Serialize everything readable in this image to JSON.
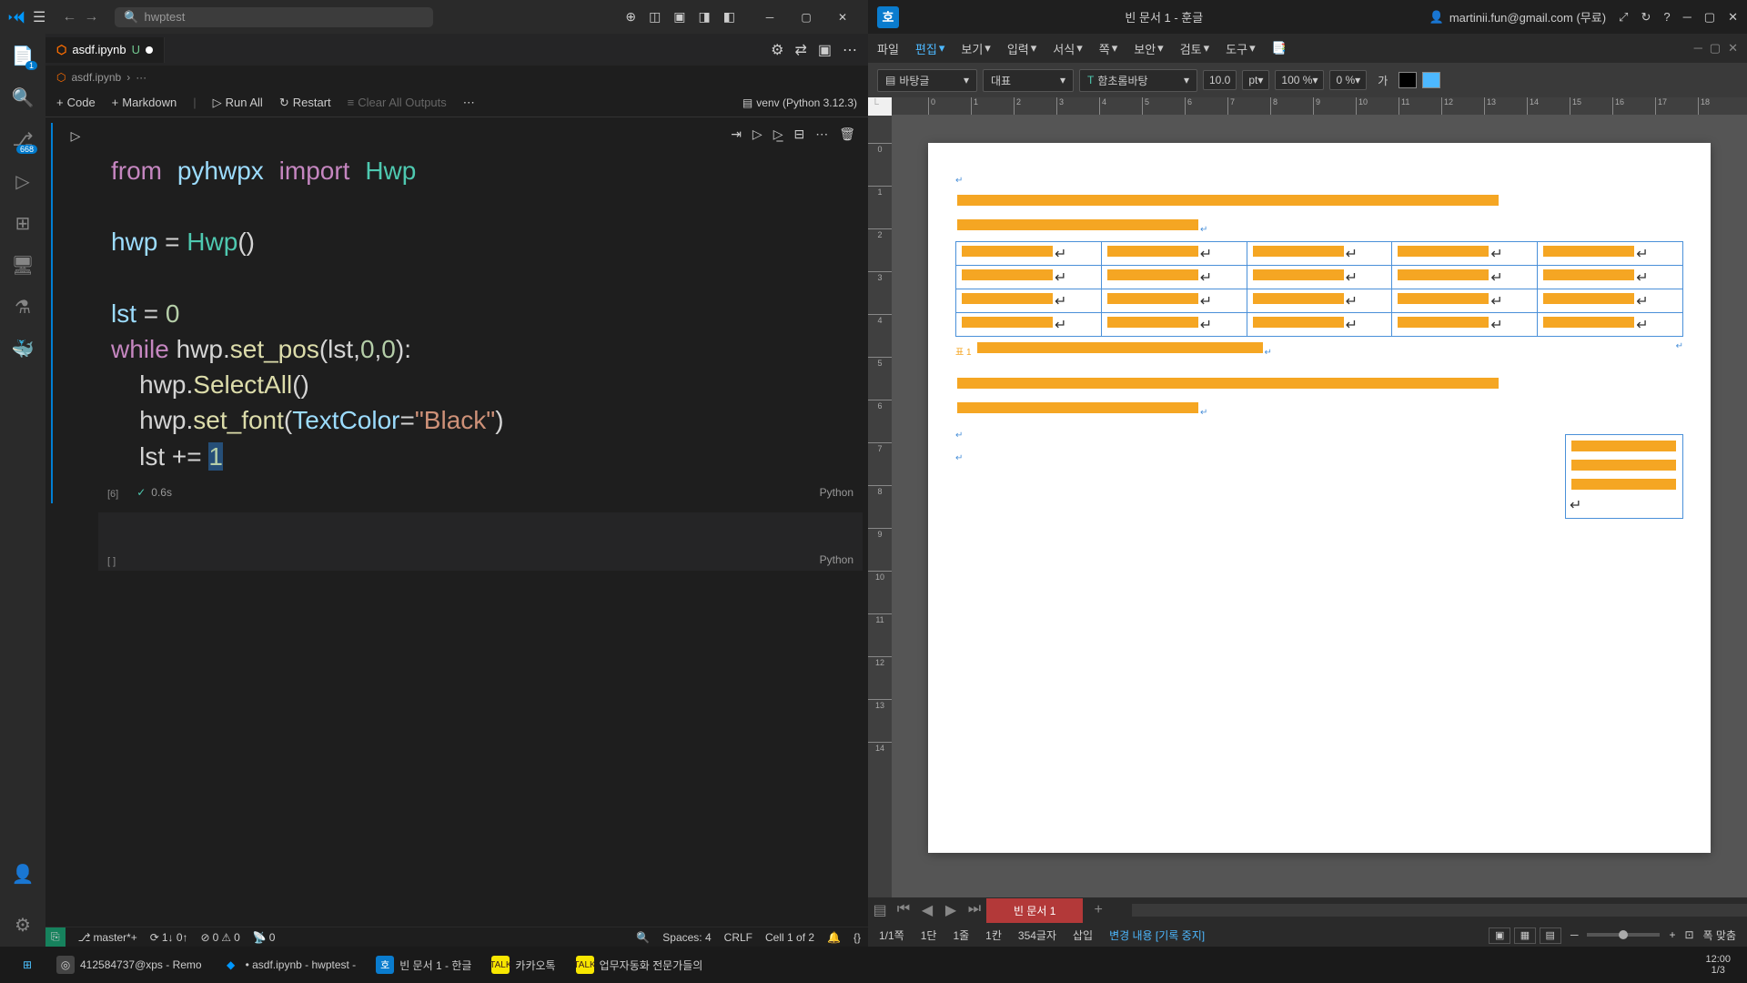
{
  "vscode": {
    "search_placeholder": "hwptest",
    "tab": {
      "name": "asdf.ipynb",
      "status": "U"
    },
    "breadcrumb": {
      "file": "asdf.ipynb",
      "path": "···"
    },
    "toolbar": {
      "code": "Code",
      "markdown": "Markdown",
      "run_all": "Run All",
      "restart": "Restart",
      "clear": "Clear All Outputs",
      "kernel": "venv (Python 3.12.3)"
    },
    "activity_badge": "668",
    "activity_explorer_badge": "1",
    "cell": {
      "prompt": "[6]",
      "exec_time": "0.6s",
      "lang": "Python"
    },
    "code": {
      "l1_from": "from",
      "l1_mod": "pyhwpx",
      "l1_import": "import",
      "l1_cls": "Hwp",
      "l3_lhs": "hwp",
      "l3_eq": " = ",
      "l3_cls": "Hwp",
      "l3_par": "()",
      "l5_lhs": "lst",
      "l5_eq": " = ",
      "l5_val": "0",
      "l6_kw": "while",
      "l6_expr1": " hwp.",
      "l6_fn": "set_pos",
      "l6_args": "(lst,",
      "l6_n1": "0",
      "l6_c": ",",
      "l6_n2": "0",
      "l6_end": "):",
      "l7_expr": "    hwp.",
      "l7_fn": "SelectAll",
      "l7_par": "()",
      "l8_expr": "    hwp.",
      "l8_fn": "set_font",
      "l8_open": "(",
      "l8_kw": "TextColor",
      "l8_eq": "=",
      "l8_str": "\"Black\"",
      "l8_close": ")",
      "l9_expr": "    lst += ",
      "l9_val": "1"
    },
    "empty_lang": "Python",
    "empty_prompt": "[ ]",
    "status": {
      "branch": "master*+",
      "sync": "1↓ 0↑",
      "errors": "0",
      "warnings": "0",
      "ports": "0",
      "spaces": "Spaces: 4",
      "eol": "CRLF",
      "cell": "Cell 1 of 2"
    }
  },
  "hwp": {
    "title": "빈 문서 1 - 훈글",
    "user": "martinii.fun@gmail.com (무료)",
    "menus": [
      "파일",
      "편집",
      "보기",
      "입력",
      "서식",
      "쪽",
      "보안",
      "검토",
      "도구"
    ],
    "toolbar": {
      "style": "바탕글",
      "lang": "대표",
      "font": "함초롬바탕",
      "size": "10.0",
      "unit": "pt",
      "zoom": "100 %",
      "char_spacing": "0 %",
      "ga": "가"
    },
    "annotation": "표 1",
    "doc_tab": "빈 문서 1",
    "status": {
      "page": "1/1쪽",
      "dan": "1단",
      "line": "1줄",
      "col": "1칸",
      "chars": "354글자",
      "mode": "삽입",
      "track": "변경 내용 [기록 중지]",
      "fit": "폭 맞춤"
    }
  },
  "taskbar": {
    "items": [
      {
        "label": "412584737@xps - Remo",
        "color": "#777"
      },
      {
        "label": "• asdf.ipynb - hwptest -",
        "color": "#0098ff"
      },
      {
        "label": "빈 문서 1 - 한글",
        "color": "#0a7cce"
      },
      {
        "label": "카카오톡",
        "color": "#f7e600"
      },
      {
        "label": "업무자동화 전문가들의",
        "color": "#f7e600"
      }
    ],
    "time": "12:00",
    "date": "1/3"
  }
}
